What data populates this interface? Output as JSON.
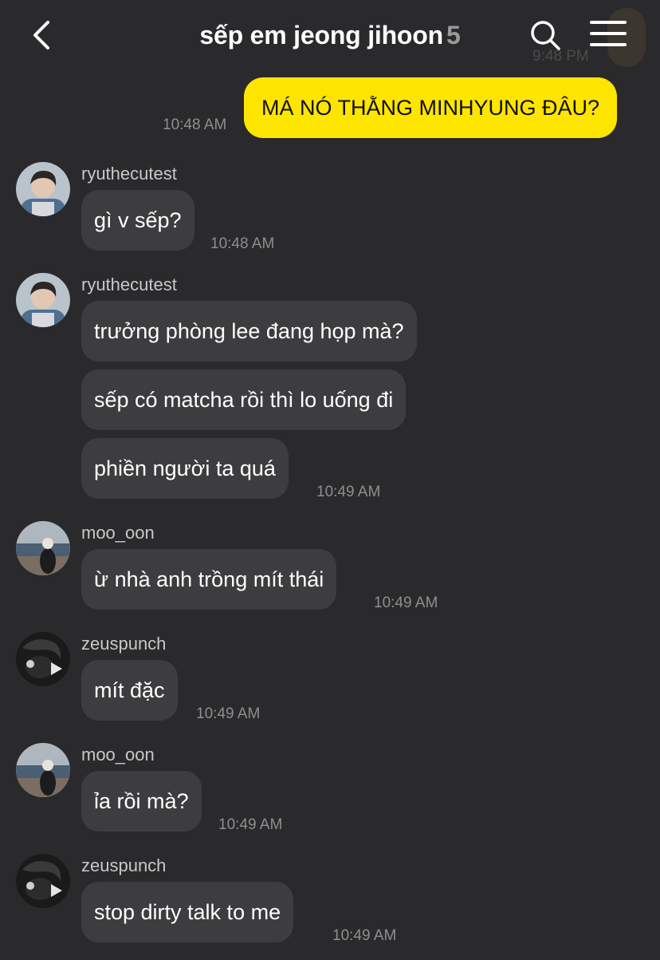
{
  "header": {
    "title": "sếp em jeong jihoon",
    "member_count": "5",
    "ghost_time": "9:48 PM"
  },
  "outgoing": {
    "text": "MÁ NÓ THẰNG MINHYUNG ĐÂU?",
    "time": "10:48 AM"
  },
  "groups": [
    {
      "sender": "ryuthecutest",
      "avatar": "avatar-ryu",
      "messages": [
        "gì v sếp?"
      ],
      "time": "10:48 AM"
    },
    {
      "sender": "ryuthecutest",
      "avatar": "avatar-ryu",
      "messages": [
        "trưởng phòng lee đang họp mà?",
        "sếp có matcha rồi thì lo uống đi",
        "phiền người ta quá"
      ],
      "time": "10:49 AM"
    },
    {
      "sender": "moo_oon",
      "avatar": "avatar-moo",
      "messages": [
        "ừ nhà anh trồng mít thái"
      ],
      "time": "10:49 AM"
    },
    {
      "sender": "zeuspunch",
      "avatar": "avatar-zeus",
      "messages": [
        "mít đặc"
      ],
      "time": "10:49 AM"
    },
    {
      "sender": "moo_oon",
      "avatar": "avatar-moo",
      "messages": [
        "ỉa rồi mà?"
      ],
      "time": "10:49 AM"
    },
    {
      "sender": "zeuspunch",
      "avatar": "avatar-zeus",
      "messages": [
        "stop dirty talk to me"
      ],
      "time": "10:49 AM"
    }
  ],
  "colors": {
    "background": "#2a2a2c",
    "outgoing_bubble": "#fee500",
    "incoming_bubble": "#3d3d3f",
    "timestamp": "#8e8e8e"
  }
}
